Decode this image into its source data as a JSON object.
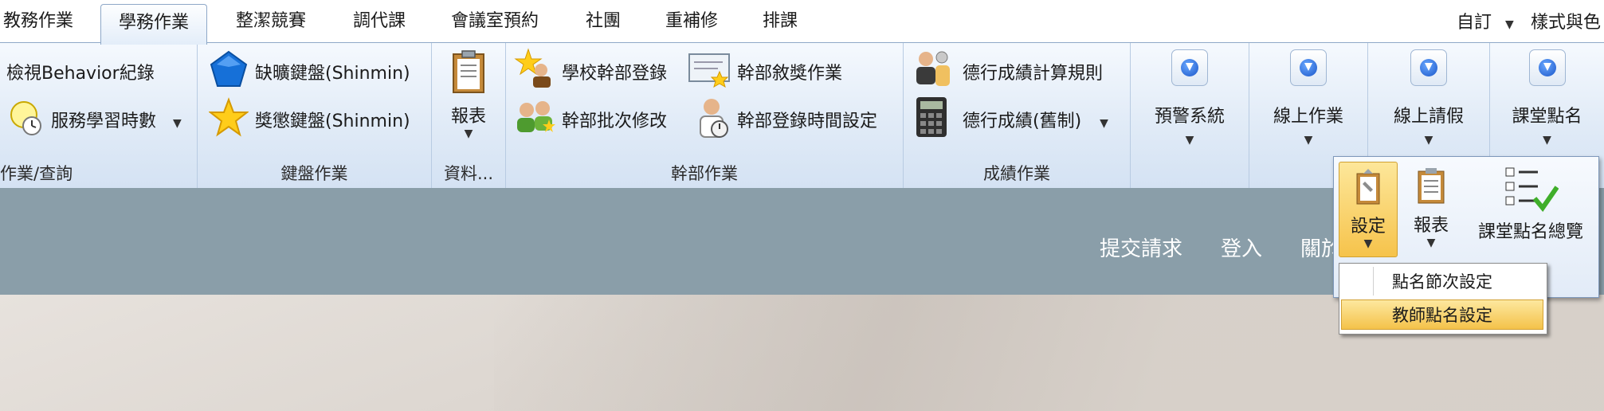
{
  "tabs": [
    {
      "label": "教務作業",
      "active": false
    },
    {
      "label": "學務作業",
      "active": true
    },
    {
      "label": "整潔競賽",
      "active": false
    },
    {
      "label": "調代課",
      "active": false
    },
    {
      "label": "會議室預約",
      "active": false
    },
    {
      "label": "社團",
      "active": false
    },
    {
      "label": "重補修",
      "active": false
    },
    {
      "label": "排課",
      "active": false
    }
  ],
  "right_tools": {
    "custom": "自訂",
    "style": "樣式與色"
  },
  "ribbon": {
    "group_query": {
      "label": "作業/查詢",
      "item1": "檢視Behavior紀錄",
      "item2": "服務學習時數"
    },
    "group_keyboard": {
      "label": "鍵盤作業",
      "item1": "缺曠鍵盤(Shinmin)",
      "item2": "獎懲鍵盤(Shinmin)"
    },
    "group_data": {
      "label": "資料...",
      "report": "報表"
    },
    "group_cadre": {
      "label": "幹部作業",
      "item1": "學校幹部登錄",
      "item2": "幹部敘獎作業",
      "item3": "幹部批次修改",
      "item4": "幹部登錄時間設定"
    },
    "group_score": {
      "label": "成績作業",
      "item1": "德行成績計算規則",
      "item2": "德行成績(舊制)"
    },
    "big_buttons": [
      "預警系統",
      "線上作業",
      "線上請假",
      "課堂點名"
    ]
  },
  "slate": {
    "links": [
      "提交請求",
      "登入",
      "關於"
    ]
  },
  "popup": {
    "settings": "設定",
    "report": "報表",
    "overview": "課堂點名總覽"
  },
  "submenu": {
    "items": [
      "點名節次設定",
      "教師點名設定"
    ],
    "highlighted_index": 1
  },
  "colors": {
    "ribbon_border": "#8ea8c8",
    "slate": "#8a9ea9",
    "highlight": "#f6c34b"
  }
}
